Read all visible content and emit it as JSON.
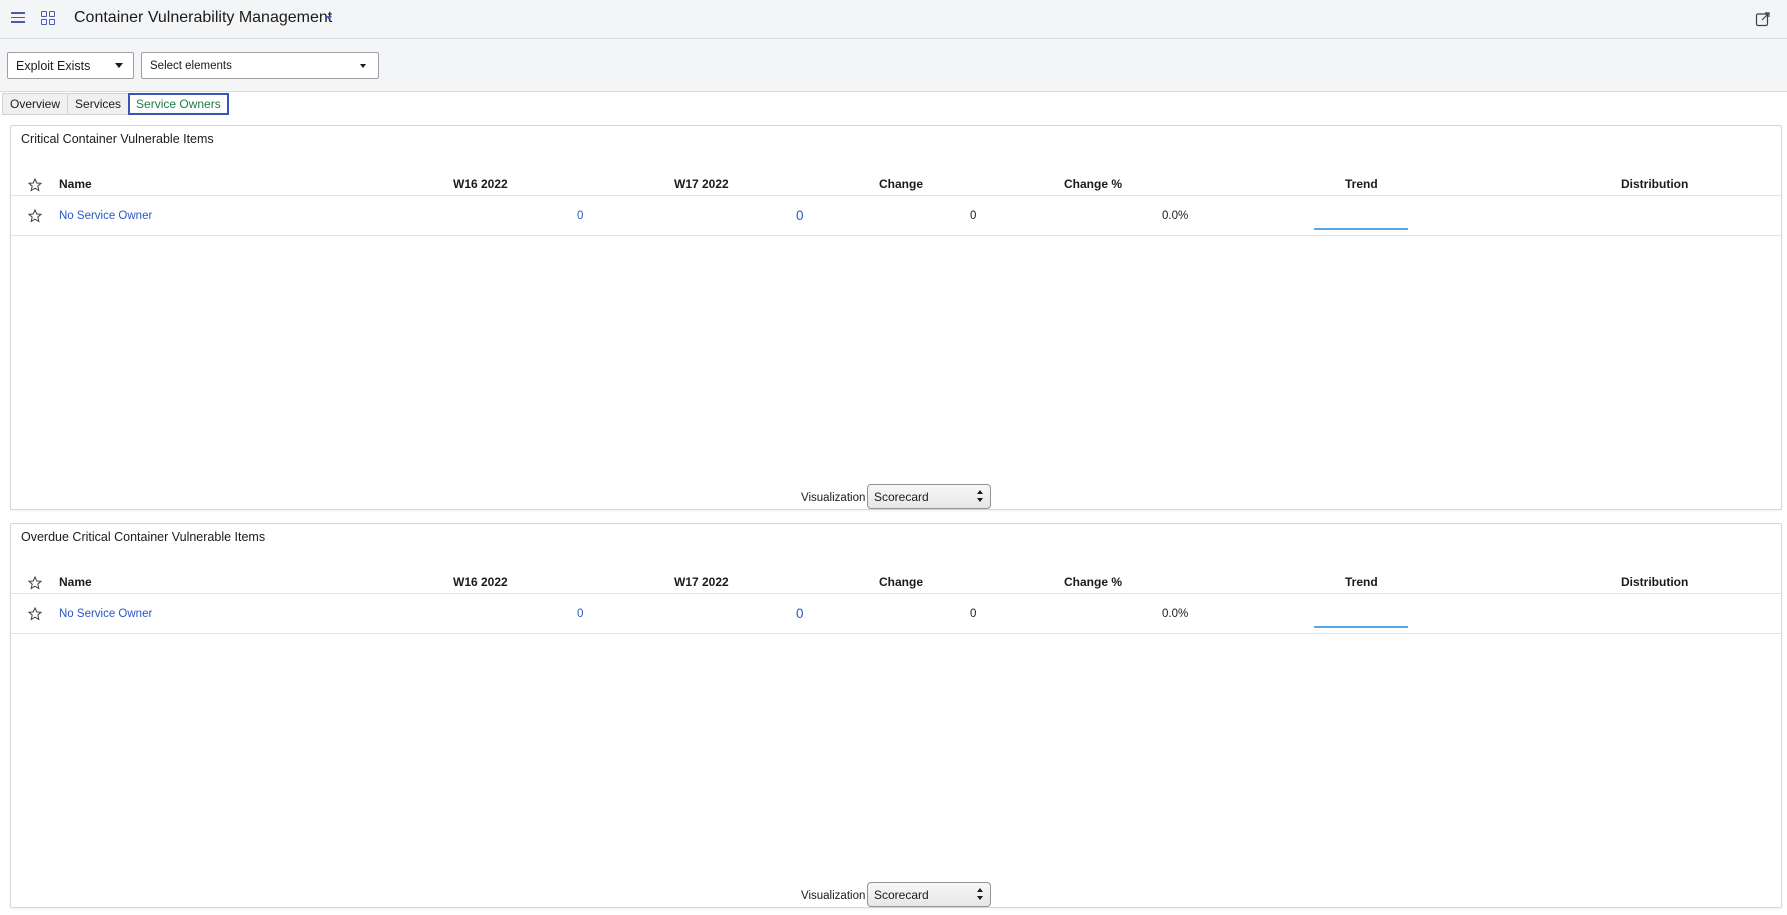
{
  "header": {
    "title": "Container Vulnerability Management"
  },
  "filters": {
    "filter1_value": "Exploit Exists",
    "filter2_placeholder": "Select elements"
  },
  "tabs": [
    {
      "label": "Overview"
    },
    {
      "label": "Services"
    },
    {
      "label": "Service Owners",
      "active": true
    }
  ],
  "panels": [
    {
      "title": "Critical Container Vulnerable Items",
      "columns": {
        "name": "Name",
        "w16": "W16 2022",
        "w17": "W17 2022",
        "change": "Change",
        "change_pct": "Change %",
        "trend": "Trend",
        "distribution": "Distribution"
      },
      "rows": [
        {
          "name": "No Service Owner",
          "w16": "0",
          "w17": "0",
          "change": "0",
          "change_pct": "0.0%"
        }
      ],
      "visualization_label": "Visualization",
      "visualization_value": "Scorecard"
    },
    {
      "title": "Overdue Critical Container Vulnerable Items",
      "columns": {
        "name": "Name",
        "w16": "W16 2022",
        "w17": "W17 2022",
        "change": "Change",
        "change_pct": "Change %",
        "trend": "Trend",
        "distribution": "Distribution"
      },
      "rows": [
        {
          "name": "No Service Owner",
          "w16": "0",
          "w17": "0",
          "change": "0",
          "change_pct": "0.0%"
        }
      ],
      "visualization_label": "Visualization",
      "visualization_value": "Scorecard"
    }
  ],
  "colors": {
    "accent": "#4a5ab0",
    "link": "#2a56c6",
    "active_tab_text": "#1d7a44",
    "trend_line": "#55a6e8"
  },
  "icons": [
    "menu-icon",
    "apps-grid-icon",
    "chevron-down-icon",
    "export-icon",
    "star-icon"
  ]
}
